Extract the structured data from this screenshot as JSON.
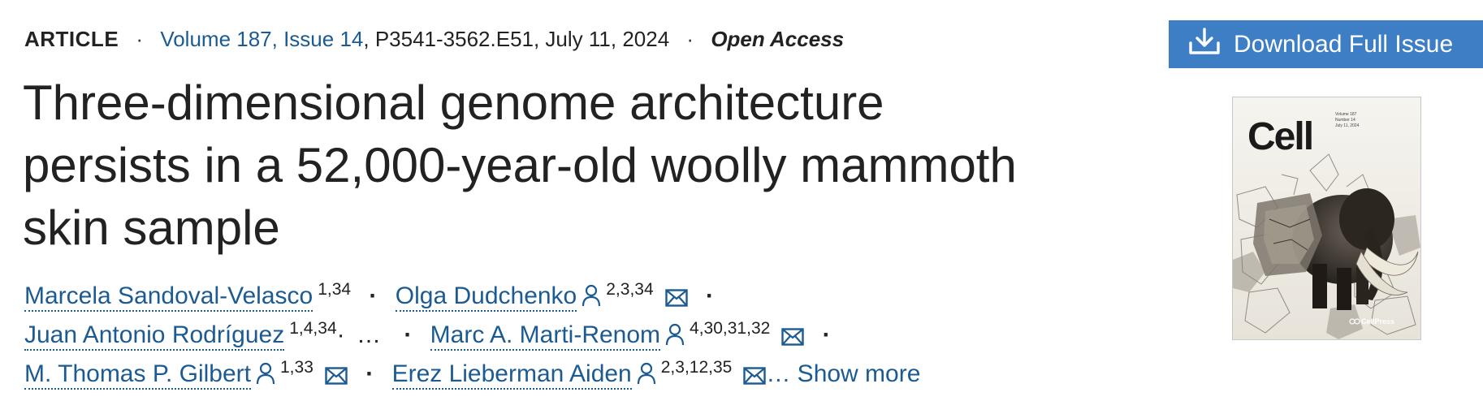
{
  "article": {
    "type": "ARTICLE",
    "volume_issue": "Volume 187, Issue 14",
    "pages": ", P3541-3562.E51, July 11, 2024",
    "access": "Open Access",
    "separator": "·",
    "title": "Three-dimensional genome architecture persists in a 52,000-year-old woolly mammoth skin sample"
  },
  "authors": {
    "separator": "·",
    "ellipsis": "…",
    "show_more": "… Show more",
    "list": [
      {
        "name": "Marcela Sandoval-Velasco",
        "affiliations": "1,34"
      },
      {
        "name": "Olga Dudchenko",
        "affiliations": "2,3,34"
      },
      {
        "name": "Juan Antonio Rodríguez",
        "affiliations": "1,4,34"
      },
      {
        "name": "Marc A. Marti-Renom",
        "affiliations": "4,30,31,32"
      },
      {
        "name": "M. Thomas P. Gilbert",
        "affiliations": "1,33"
      },
      {
        "name": "Erez Lieberman Aiden",
        "affiliations": "2,3,12,35"
      }
    ]
  },
  "download": {
    "label": "Download Full Issue",
    "color": "#3d7ec5",
    "icon": "download-icon"
  },
  "cover": {
    "journal": "Cell",
    "publisher_mark": "CellPress",
    "volume_text": "Volume 187",
    "issue_text": "Number 14",
    "date_text": "July 11, 2024"
  },
  "colors": {
    "link": "#1c5b92",
    "text": "#222222"
  }
}
